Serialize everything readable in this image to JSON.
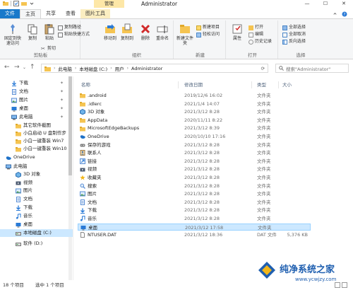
{
  "window": {
    "title": "Administrator",
    "manage_tab": "管理",
    "minimize": "—",
    "maximize": "☐",
    "close": "✕"
  },
  "ribbon_tabs": [
    {
      "label": "文件"
    },
    {
      "label": "主页"
    },
    {
      "label": "共享"
    },
    {
      "label": "查看"
    },
    {
      "label": "图片工具"
    }
  ],
  "ribbon": {
    "clipboard": {
      "label": "剪贴板",
      "pin": "固定到快速访问",
      "copy": "复制",
      "paste": "粘贴",
      "cut": "剪切",
      "copy_path": "复制路径",
      "paste_shortcut": "粘贴快捷方式"
    },
    "organize": {
      "label": "组织",
      "move_to": "移动到",
      "copy_to": "复制到",
      "delete": "删除",
      "rename": "重命名"
    },
    "new": {
      "label": "新建",
      "new_folder": "新建文件夹",
      "new_item": "新建项目",
      "easy_access": "轻松访问"
    },
    "open": {
      "label": "打开",
      "properties": "属性",
      "open": "打开",
      "edit": "编辑",
      "history": "历史记录"
    },
    "select": {
      "label": "选择",
      "select_all": "全部选择",
      "select_none": "全部取消",
      "invert": "反向选择"
    }
  },
  "address": {
    "crumbs": [
      "此电脑",
      "本地磁盘 (C:)",
      "用户",
      "Administrator"
    ],
    "search_placeholder": "搜索\"Administrator\""
  },
  "nav_items": [
    {
      "label": "下载",
      "icon": "download-icon",
      "pinned": true
    },
    {
      "label": "文档",
      "icon": "document-icon",
      "pinned": true
    },
    {
      "label": "图片",
      "icon": "picture-icon",
      "pinned": true
    },
    {
      "label": "桌面",
      "icon": "desktop-icon",
      "pinned": true
    },
    {
      "label": "此电脑",
      "icon": "computer-icon",
      "pinned": true
    },
    {
      "label": "其它软件截图",
      "icon": "folder-icon",
      "pinned": false
    },
    {
      "label": "小白启动 U 盘制作步",
      "icon": "folder-icon",
      "pinned": false
    },
    {
      "label": "小白一键重装 Win7",
      "icon": "folder-icon",
      "pinned": false
    },
    {
      "label": "小白一键重装 Win10",
      "icon": "folder-icon",
      "pinned": false
    },
    {
      "label": "OneDrive",
      "icon": "onedrive-icon",
      "pinned": false
    },
    {
      "label": "此电脑",
      "icon": "computer-icon",
      "pinned": false
    },
    {
      "label": "3D 对象",
      "icon": "3d-objects-icon",
      "pinned": false
    },
    {
      "label": "视频",
      "icon": "video-icon",
      "pinned": false
    },
    {
      "label": "图片",
      "icon": "picture-icon",
      "pinned": false
    },
    {
      "label": "文档",
      "icon": "document-icon",
      "pinned": false
    },
    {
      "label": "下载",
      "icon": "download-icon",
      "pinned": false
    },
    {
      "label": "音乐",
      "icon": "music-icon",
      "pinned": false
    },
    {
      "label": "桌面",
      "icon": "desktop-icon",
      "pinned": false
    },
    {
      "label": "本地磁盘 (C:)",
      "icon": "drive-icon",
      "pinned": false,
      "selected": true
    },
    {
      "label": "软件 (D:)",
      "icon": "drive-icon",
      "pinned": false
    }
  ],
  "columns": {
    "name": "名称",
    "date": "修改日期",
    "type": "类型",
    "size": "大小"
  },
  "files": [
    {
      "name": ".android",
      "date": "2019/12/6 16:02",
      "type": "文件夹",
      "size": "",
      "icon": "folder-icon"
    },
    {
      "name": ".idlerc",
      "date": "2021/1/4 14:07",
      "type": "文件夹",
      "size": "",
      "icon": "folder-icon"
    },
    {
      "name": "3D 对象",
      "date": "2021/3/12 8:28",
      "type": "文件夹",
      "size": "",
      "icon": "3d-objects-icon"
    },
    {
      "name": "AppData",
      "date": "2020/11/11 8:22",
      "type": "文件夹",
      "size": "",
      "icon": "folder-icon"
    },
    {
      "name": "MicrosoftEdgeBackups",
      "date": "2021/3/12 8:39",
      "type": "文件夹",
      "size": "",
      "icon": "folder-icon"
    },
    {
      "name": "OneDrive",
      "date": "2020/10/10 17:16",
      "type": "文件夹",
      "size": "",
      "icon": "onedrive-icon"
    },
    {
      "name": "保存的游戏",
      "date": "2021/3/12 8:28",
      "type": "文件夹",
      "size": "",
      "icon": "saved-games-icon"
    },
    {
      "name": "联系人",
      "date": "2021/3/12 8:28",
      "type": "文件夹",
      "size": "",
      "icon": "contacts-icon"
    },
    {
      "name": "链接",
      "date": "2021/3/12 8:28",
      "type": "文件夹",
      "size": "",
      "icon": "links-icon"
    },
    {
      "name": "视频",
      "date": "2021/3/12 8:28",
      "type": "文件夹",
      "size": "",
      "icon": "video-icon"
    },
    {
      "name": "收藏夹",
      "date": "2021/3/12 8:28",
      "type": "文件夹",
      "size": "",
      "icon": "favorites-icon"
    },
    {
      "name": "搜索",
      "date": "2021/3/12 8:28",
      "type": "文件夹",
      "size": "",
      "icon": "search-folder-icon"
    },
    {
      "name": "图片",
      "date": "2021/3/12 8:28",
      "type": "文件夹",
      "size": "",
      "icon": "picture-icon"
    },
    {
      "name": "文档",
      "date": "2021/3/12 8:28",
      "type": "文件夹",
      "size": "",
      "icon": "document-icon"
    },
    {
      "name": "下载",
      "date": "2021/3/12 8:28",
      "type": "文件夹",
      "size": "",
      "icon": "download-icon"
    },
    {
      "name": "音乐",
      "date": "2021/3/12 8:28",
      "type": "文件夹",
      "size": "",
      "icon": "music-icon"
    },
    {
      "name": "桌面",
      "date": "2021/3/12 17:58",
      "type": "文件夹",
      "size": "",
      "icon": "desktop-icon",
      "selected": true
    },
    {
      "name": "NTUSER.DAT",
      "date": "2021/3/12 18:36",
      "type": "DAT 文件",
      "size": "5,376 KB",
      "icon": "file-icon"
    }
  ],
  "status": {
    "count": "18 个项目",
    "selected": "选中 1 个项目"
  },
  "watermark": {
    "text": "纯净系统之家",
    "url": "www.ycwjzy.com"
  },
  "colors": {
    "accent": "#1979ca",
    "selection": "#cce8ff",
    "folder": "#f5c451"
  }
}
